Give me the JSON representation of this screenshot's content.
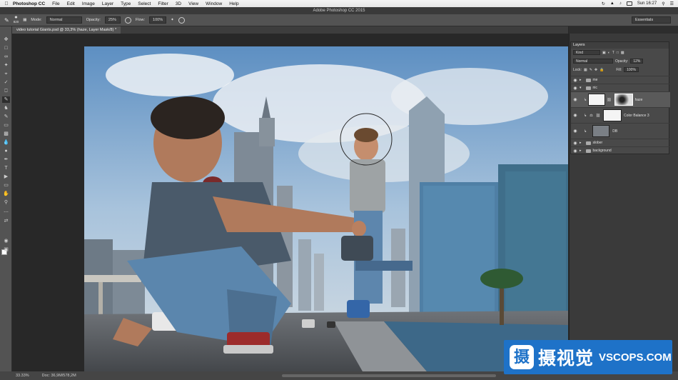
{
  "menubar": {
    "app": "Photoshop CC",
    "items": [
      "File",
      "Edit",
      "Image",
      "Layer",
      "Type",
      "Select",
      "Filter",
      "3D",
      "View",
      "Window",
      "Help"
    ],
    "clock": "Sun 16:27"
  },
  "window_title": "Adobe Photoshop CC 2015",
  "options": {
    "brush_size": "820",
    "mode_label": "Mode:",
    "mode_value": "Normal",
    "opacity_label": "Opacity:",
    "opacity_value": "25%",
    "flow_label": "Flow:",
    "flow_value": "100%",
    "workspace": "Essentials"
  },
  "document_tab": "video tutorial Giants.psd @ 33,3% (haze, Layer Mask/8) *",
  "layers_panel": {
    "title": "Layers",
    "filter": "Kind",
    "blend_mode": "Normal",
    "opacity_label": "Opacity:",
    "opacity_value": "12%",
    "lock_label": "Lock:",
    "fill_label": "Fill:",
    "fill_value": "100%",
    "layers": [
      {
        "name": "me",
        "type": "folder"
      },
      {
        "name": "nic",
        "type": "folder"
      },
      {
        "name": "haze",
        "type": "layer-mask",
        "selected": true
      },
      {
        "name": "Color Balance 3",
        "type": "adjustment"
      },
      {
        "name": "DB",
        "type": "smart-object"
      },
      {
        "name": "slober",
        "type": "folder"
      },
      {
        "name": "background",
        "type": "folder"
      }
    ]
  },
  "status": {
    "zoom": "33.33%",
    "doc": "Doc: 36,9M/578,2M"
  },
  "watermark": {
    "logo_char": "摄",
    "cn": "摄视觉",
    "en": "VSCOPS.COM"
  },
  "colors": {
    "panel_bg": "#3a3a3a",
    "toolbar_bg": "#535353",
    "watermark_blue": "#1e72c8"
  }
}
